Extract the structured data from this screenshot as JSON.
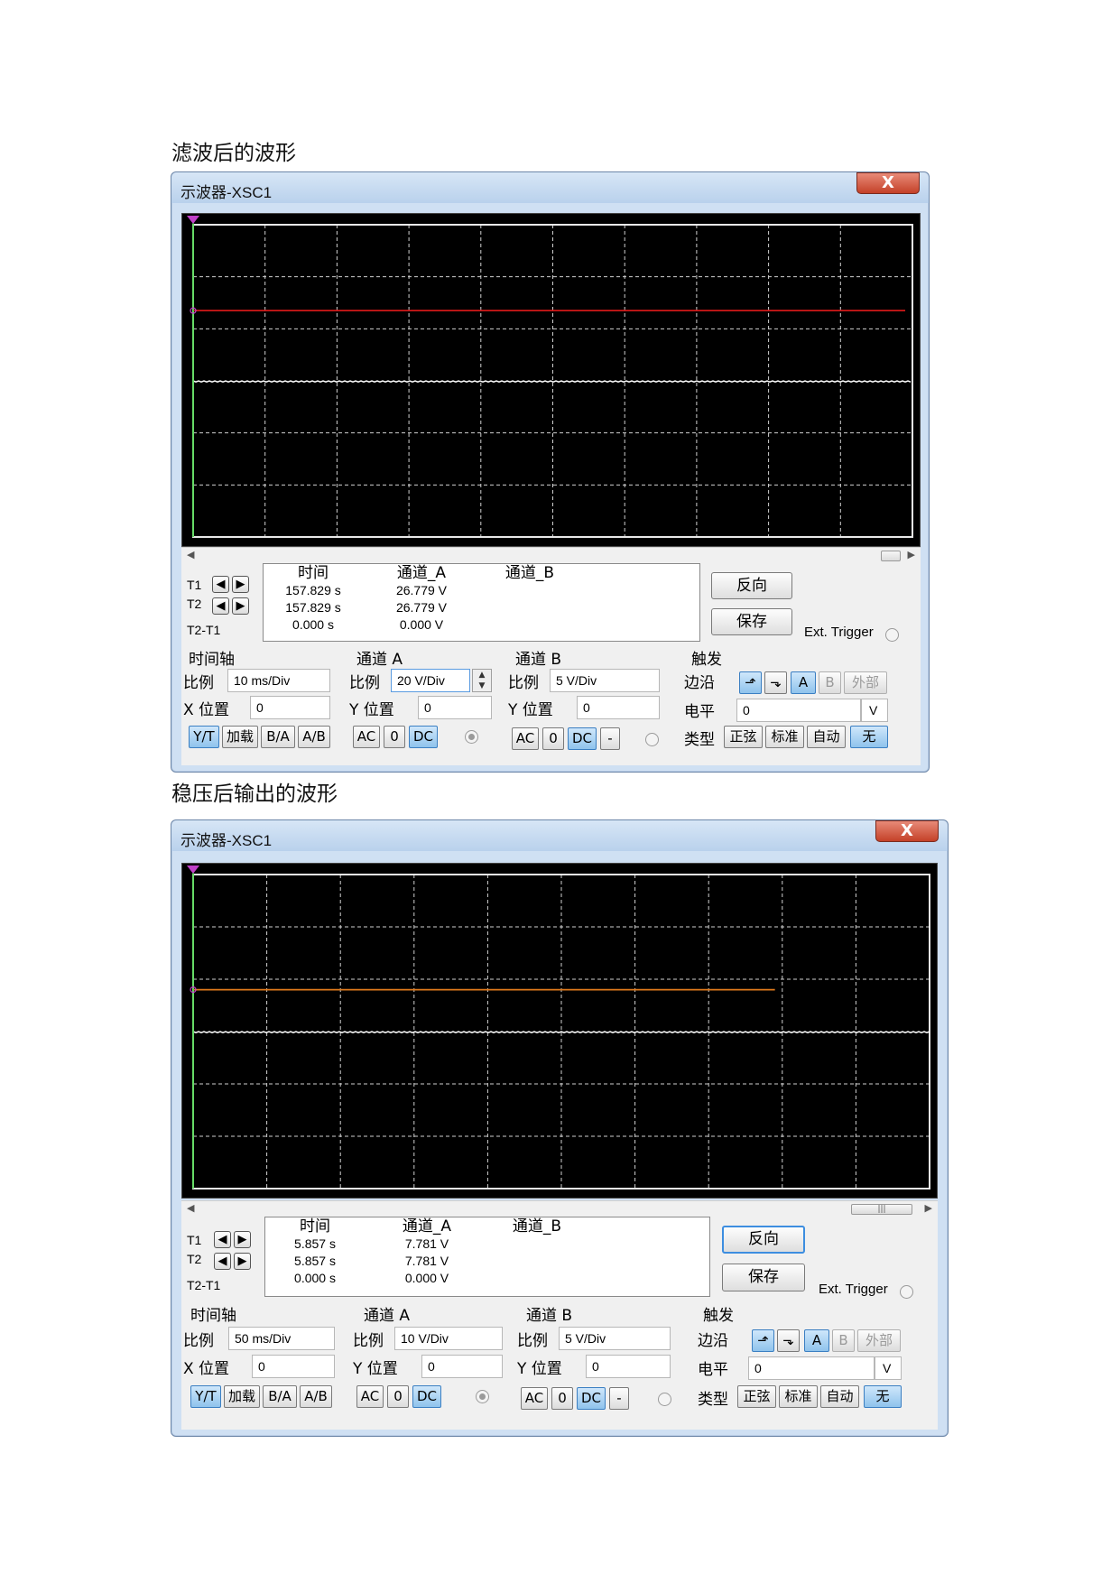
{
  "captions": [
    "滤波后的波形",
    "稳压后输出的波形"
  ],
  "scopes": [
    {
      "title": "示波器-XSC1",
      "close": "X",
      "trace_a_color": "#d01818",
      "trace_a_level_div": 1.65,
      "trace_a_end_frac": 0.99,
      "trace_b_level_div": 3.0,
      "readout": {
        "rows": [
          "T1",
          "T2",
          "T2-T1"
        ],
        "time": {
          "header": "时间",
          "t1": "157.829 s",
          "t2": "157.829 s",
          "diff": "0.000 s"
        },
        "ch_a": {
          "header": "通道_A",
          "t1": "26.779 V",
          "t2": "26.779 V",
          "diff": "0.000 V"
        },
        "ch_b": {
          "header": "通道_B"
        }
      },
      "reverse": "反向",
      "save": "保存",
      "ext_trigger": "Ext. Trigger",
      "timebase": {
        "title": "时间轴",
        "scale_label": "比例",
        "scale": "10 ms/Div",
        "pos_label": "X 位置",
        "pos": "0",
        "buttons": [
          "Y/T",
          "加载",
          "B/A",
          "A/B"
        ]
      },
      "channel_a": {
        "title": "通道 A",
        "scale_label": "比例",
        "scale": "20 V/Div",
        "pos_label": "Y 位置",
        "pos": "0",
        "buttons": [
          "AC",
          "0",
          "DC"
        ]
      },
      "channel_b": {
        "title": "通道 B",
        "scale_label": "比例",
        "scale": "5 V/Div",
        "pos_label": "Y 位置",
        "pos": "0",
        "buttons": [
          "AC",
          "0",
          "DC",
          "-"
        ]
      },
      "trigger": {
        "title": "触发",
        "edge_label": "边沿",
        "edge_buttons": [
          "⬏",
          "⬎",
          "A",
          "B",
          "外部"
        ],
        "level_label": "电平",
        "level": "0",
        "unit": "V",
        "type_label": "类型",
        "type_buttons": [
          "正弦",
          "标准",
          "自动",
          "无"
        ]
      }
    },
    {
      "title": "示波器-XSC1",
      "close": "X",
      "trace_a_color": "#e07a1c",
      "trace_a_level_div": 2.2,
      "trace_a_end_frac": 0.79,
      "trace_b_level_div": 3.0,
      "readout": {
        "rows": [
          "T1",
          "T2",
          "T2-T1"
        ],
        "time": {
          "header": "时间",
          "t1": "5.857 s",
          "t2": "5.857 s",
          "diff": "0.000 s"
        },
        "ch_a": {
          "header": "通道_A",
          "t1": "7.781 V",
          "t2": "7.781 V",
          "diff": "0.000 V"
        },
        "ch_b": {
          "header": "通道_B"
        }
      },
      "reverse": "反向",
      "save": "保存",
      "ext_trigger": "Ext. Trigger",
      "timebase": {
        "title": "时间轴",
        "scale_label": "比例",
        "scale": "50 ms/Div",
        "pos_label": "X 位置",
        "pos": "0",
        "buttons": [
          "Y/T",
          "加载",
          "B/A",
          "A/B"
        ]
      },
      "channel_a": {
        "title": "通道 A",
        "scale_label": "比例",
        "scale": "10 V/Div",
        "pos_label": "Y 位置",
        "pos": "0",
        "buttons": [
          "AC",
          "0",
          "DC"
        ]
      },
      "channel_b": {
        "title": "通道 B",
        "scale_label": "比例",
        "scale": "5 V/Div",
        "pos_label": "Y 位置",
        "pos": "0",
        "buttons": [
          "AC",
          "0",
          "DC",
          "-"
        ]
      },
      "trigger": {
        "title": "触发",
        "edge_label": "边沿",
        "edge_buttons": [
          "⬏",
          "⬎",
          "A",
          "B",
          "外部"
        ],
        "level_label": "电平",
        "level": "0",
        "unit": "V",
        "type_label": "类型",
        "type_buttons": [
          "正弦",
          "标准",
          "自动",
          "无"
        ]
      }
    }
  ]
}
